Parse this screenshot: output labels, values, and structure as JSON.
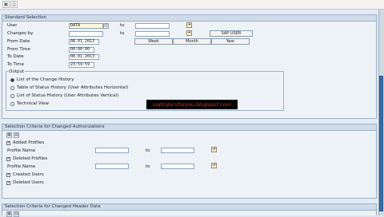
{
  "toolbar": {
    "icon1": "disk-icon",
    "icon2": "print-icon"
  },
  "standard": {
    "title": "Standard Selection",
    "user_label": "User",
    "user_value": "DATA",
    "changes_by_label": "Changes by",
    "from_date_label": "From Date",
    "from_date_value": "08.01.2013",
    "from_time_label": "From Time",
    "from_time_value": "00:00:00",
    "to_date_label": "To Date",
    "to_date_value": "08.01.2013",
    "to_time_label": "To Time",
    "to_time_value": "23:59:59",
    "to_label": "to",
    "btn_week": "Week",
    "btn_month": "Month",
    "btn_year": "Year",
    "btn_sapuser": "SAP USER"
  },
  "output": {
    "title": "Output",
    "options": [
      "List of the Change History",
      "Table of Status History (User Attributes Horizontal)",
      "List of Status History (User Attributes Vertical)",
      "Technical View"
    ],
    "selected_index": 0
  },
  "watermark": "saptopicsforyou.blogspot.com",
  "auth": {
    "title": "Selection Criteria for Changed Authorizations",
    "added_profiles": "Added Profiles",
    "profile_name": "Profile Name",
    "deleted_profiles": "Deleted Profiles",
    "profile_name2": "Profile Name",
    "created_users": "Created Users",
    "deleted_users": "Deleted Users",
    "to_label": "to"
  },
  "header": {
    "title": "Selection Criteria for Changed Header Data"
  }
}
